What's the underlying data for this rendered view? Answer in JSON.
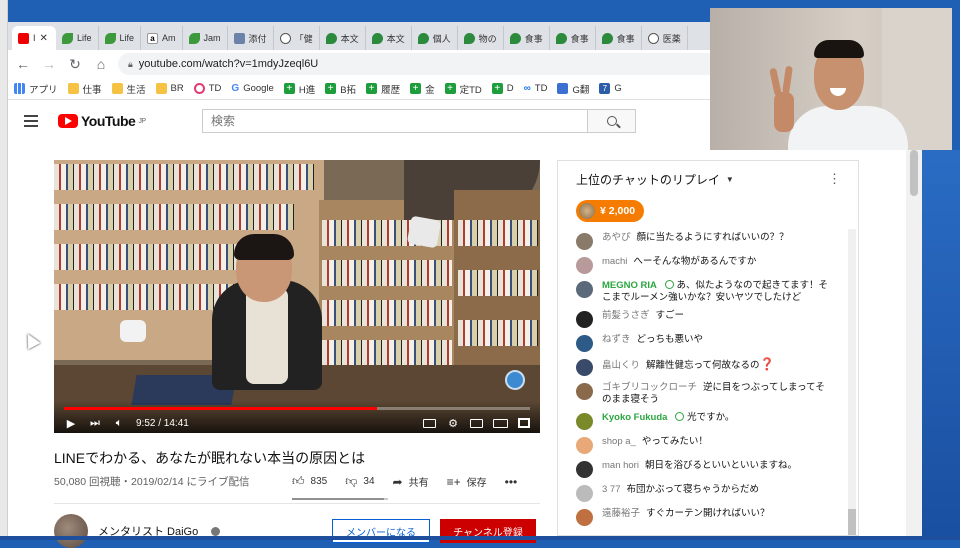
{
  "tabs": [
    {
      "icon": "youtube-icon",
      "label": "I"
    },
    {
      "icon": "leaf-icon",
      "label": "Life"
    },
    {
      "icon": "leaf-icon",
      "label": "Life"
    },
    {
      "icon": "amazon-icon",
      "label": "Am"
    },
    {
      "icon": "leaf-icon",
      "label": "Jam"
    },
    {
      "icon": "image-icon",
      "label": "添付"
    },
    {
      "icon": "globe-icon",
      "label": "「健"
    },
    {
      "icon": "pin-icon",
      "label": "本文"
    },
    {
      "icon": "pin-icon",
      "label": "本文"
    },
    {
      "icon": "pin-icon",
      "label": "個人"
    },
    {
      "icon": "pin-icon",
      "label": "物の"
    },
    {
      "icon": "pin-icon",
      "label": "食事"
    },
    {
      "icon": "pin-icon",
      "label": "食事"
    },
    {
      "icon": "pin-icon",
      "label": "食事"
    },
    {
      "icon": "globe-icon",
      "label": "医薬"
    }
  ],
  "address": {
    "url": "youtube.com/watch?v=1mdyJzeql6U"
  },
  "bookmarks": [
    {
      "icon": "apps",
      "label": "アプリ"
    },
    {
      "icon": "folder",
      "label": "仕事"
    },
    {
      "icon": "folder",
      "label": "生活"
    },
    {
      "icon": "folder",
      "label": "BR"
    },
    {
      "icon": "ring",
      "label": "TD"
    },
    {
      "icon": "g",
      "label": "Google"
    },
    {
      "icon": "plus",
      "label": "H進"
    },
    {
      "icon": "plus",
      "label": "B拓"
    },
    {
      "icon": "plus",
      "label": "履歴"
    },
    {
      "icon": "plus",
      "label": "金"
    },
    {
      "icon": "plus",
      "label": "定TD"
    },
    {
      "icon": "plus",
      "label": "D"
    },
    {
      "icon": "inf",
      "label": "TD"
    },
    {
      "icon": "dl",
      "label": "G翻"
    },
    {
      "icon": "seven",
      "label": "G"
    }
  ],
  "youtube": {
    "logo_text": "YouTube",
    "logo_region": "JP",
    "search_placeholder": "検索"
  },
  "player": {
    "current_time": "9:52",
    "duration": "14:41",
    "time_display": "9:52 / 14:41",
    "progress": 0.672
  },
  "video": {
    "title": "LINEでわかる、あなたが眠れない本当の原因とは",
    "meta": "50,080 回視聴・2019/02/14 にライブ配信",
    "likes": "835",
    "dislikes": "34",
    "share_label": "共有",
    "save_label": "保存",
    "like_ratio": 0.961,
    "channel_name": "メンタリスト DaiGo",
    "member_button": "メンバーになる",
    "subscribe_button": "チャンネル登録"
  },
  "chat": {
    "header": "上位のチャットのリプレイ",
    "superchat_amount": "¥ 2,000",
    "colors": {
      "superchat": "#f57c00",
      "member": "#2ba640",
      "subscribe": "#cc0000"
    },
    "messages": [
      {
        "author": "あやぴ",
        "text": "顔に当たるようにすればいいの？？",
        "member": false,
        "avatar": "#8a7a6a"
      },
      {
        "author": "machi",
        "text": "へーそんな物があるんですか",
        "member": false,
        "avatar": "#b89a9a"
      },
      {
        "author": "MEGNO RIA",
        "text": "あ、似たようなので起きてます！そこまでルーメン強いかな？安いヤツでしたけど",
        "member": true,
        "avatar": "#5a6a7a"
      },
      {
        "author": "前髪うさぎ",
        "text": "すごー",
        "member": false,
        "avatar": "#222222"
      },
      {
        "author": "ねずき",
        "text": "どっちも悪いや",
        "member": false,
        "avatar": "#2e5a88"
      },
      {
        "author": "畠山くり",
        "text": "解離性健忘って何故なるの",
        "member": false,
        "avatar": "#3a4a6a",
        "emoji": "❓"
      },
      {
        "author": "ゴキブリコックローチ",
        "text": "逆に目をつぶってしまってそのまま寝そう",
        "member": false,
        "avatar": "#8a6a4a"
      },
      {
        "author": "Kyoko Fukuda",
        "text": "光ですか。",
        "member": true,
        "avatar": "#7a8a2a"
      },
      {
        "author": "shop a_",
        "text": "やってみたい！",
        "member": false,
        "avatar": "#e8a878"
      },
      {
        "author": "man hori",
        "text": "朝日を浴びるといいといいますね。",
        "member": false,
        "avatar": "#333333"
      },
      {
        "author": "3 77",
        "text": "布団かぶって寝ちゃうからだめ",
        "member": false,
        "avatar": "#bbbbbb"
      },
      {
        "author": "遠藤裕子",
        "text": "すぐカーテン開ければいい？",
        "member": false,
        "avatar": "#c07040"
      }
    ]
  }
}
